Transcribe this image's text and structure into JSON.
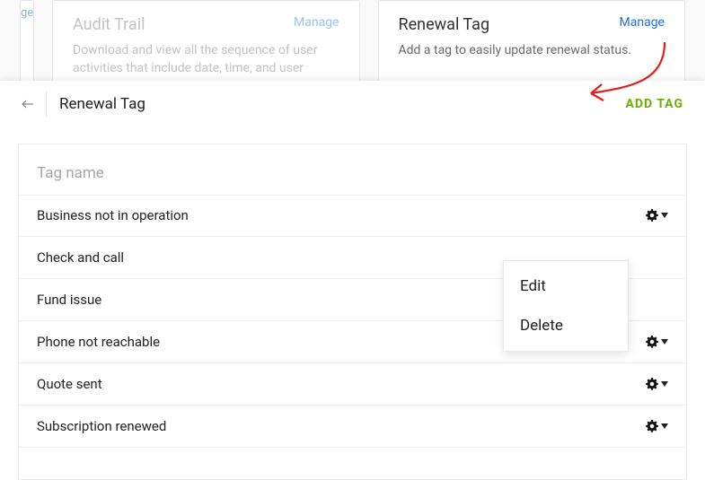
{
  "bg": {
    "sliver_label": "ge",
    "audit": {
      "title": "Audit Trail",
      "manage": "Manage",
      "desc": "Download and view all the sequence of user activities that include date, time, and user"
    },
    "renewal": {
      "title": "Renewal Tag",
      "manage": "Manage",
      "desc": "Add a tag to easily update renewal status."
    }
  },
  "panel": {
    "title": "Renewal Tag",
    "add_label": "ADD TAG",
    "column_head": "Tag name"
  },
  "tags": [
    {
      "name": "Business not in operation"
    },
    {
      "name": "Check and call"
    },
    {
      "name": "Fund issue"
    },
    {
      "name": "Phone not reachable"
    },
    {
      "name": "Quote sent"
    },
    {
      "name": "Subscription renewed"
    }
  ],
  "menu": {
    "edit": "Edit",
    "delete": "Delete"
  }
}
